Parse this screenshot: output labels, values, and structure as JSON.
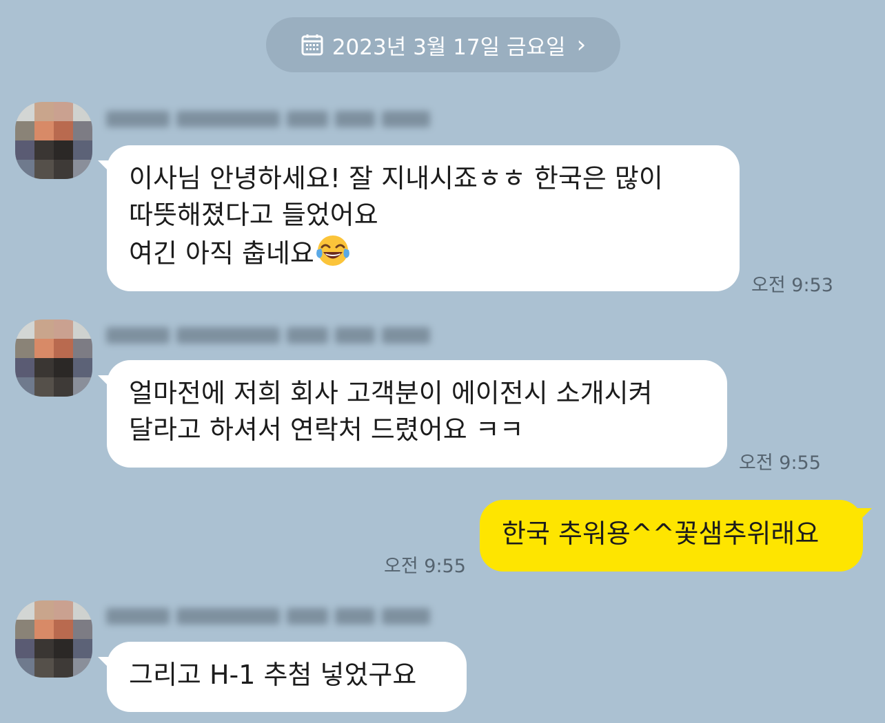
{
  "date_header": {
    "label": "2023년 3월 17일 금요일",
    "calendar_icon": "calendar-icon",
    "chevron_icon": "chevron-right-icon",
    "chevron_glyph": "›"
  },
  "messages": [
    {
      "direction": "incoming",
      "lines": [
        "이사님 안녕하세요! 잘 지내시죠ㅎㅎ 한국은 많이",
        "따뜻해졌다고 들었어요",
        "여긴 아직 춥네요"
      ],
      "emoji": "tears-of-joy-emoji",
      "time": "오전 9:53"
    },
    {
      "direction": "incoming",
      "lines": [
        "얼마전에 저희 회사 고객분이 에이전시 소개시켜",
        "달라고 하셔서 연락처 드렸어요 ㅋㅋ"
      ],
      "time": "오전 9:55"
    },
    {
      "direction": "outgoing",
      "lines": [
        "한국 추워용^^꽃샘추위래요"
      ],
      "time": "오전 9:55"
    },
    {
      "direction": "incoming",
      "lines": [
        "그리고 H-1 추첨 넣었구요"
      ]
    }
  ],
  "colors": {
    "background": "#abc1d2",
    "incoming_bubble": "#ffffff",
    "outgoing_bubble": "#fee500",
    "date_pill": "#9aafc0",
    "timestamp": "#55636f"
  }
}
